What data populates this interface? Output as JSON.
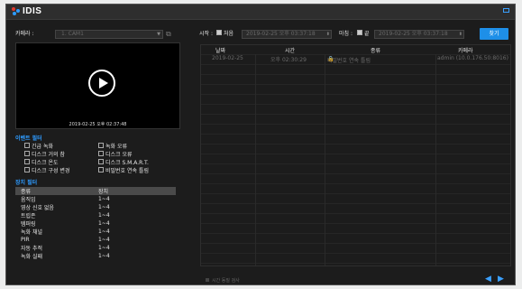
{
  "app": {
    "logo_text": "IDIS",
    "colors": {
      "accent": "#1e8fe8",
      "section": "#2e9bff",
      "logo_red": "#e03a2f",
      "logo_blue": "#2e9bff"
    }
  },
  "camera": {
    "label": "카메라 :",
    "value": "1. CAM1"
  },
  "video": {
    "timestamp": "2019-02-25 오후 02:37:48"
  },
  "event_filter": {
    "title": "이벤트 필터",
    "items": [
      "긴급 녹화",
      "녹화 오류",
      "디스크 거의 참",
      "디스크 오류",
      "디스크 온도",
      "디스크 S.M.A.R.T.",
      "디스크 구성 변경",
      "비밀번호 연속 틀림"
    ]
  },
  "device_filter": {
    "title": "장치 필터",
    "headers": [
      "종류",
      "장치"
    ],
    "rows": [
      [
        "움직임",
        "1~4"
      ],
      [
        "영상 신호 없음",
        "1~4"
      ],
      [
        "트립존",
        "1~4"
      ],
      [
        "템퍼링",
        "1~4"
      ],
      [
        "녹화 채널",
        "1~4"
      ],
      [
        "PIR",
        "1~4"
      ],
      [
        "자동 추적",
        "1~4"
      ],
      [
        "녹화 실패",
        "1~4"
      ]
    ]
  },
  "search": {
    "start_label": "시작 :",
    "start_check": "처음",
    "start_value": "2019-02-25 오후 03:37:18",
    "end_label": "마침 :",
    "end_check": "끝",
    "end_value": "2019-02-25 오후 03:37:18",
    "button": "찾기"
  },
  "results": {
    "headers": [
      "날짜",
      "시간",
      "종류",
      "카메라"
    ],
    "rows": [
      {
        "date": "2019-02-25",
        "time": "오후 02:30:29",
        "type": "비밀번호 연속 틀림",
        "camera": "admin (10.0.176.50:8016)"
      }
    ]
  },
  "footer": {
    "checkbox": "시간 동질 검사"
  }
}
